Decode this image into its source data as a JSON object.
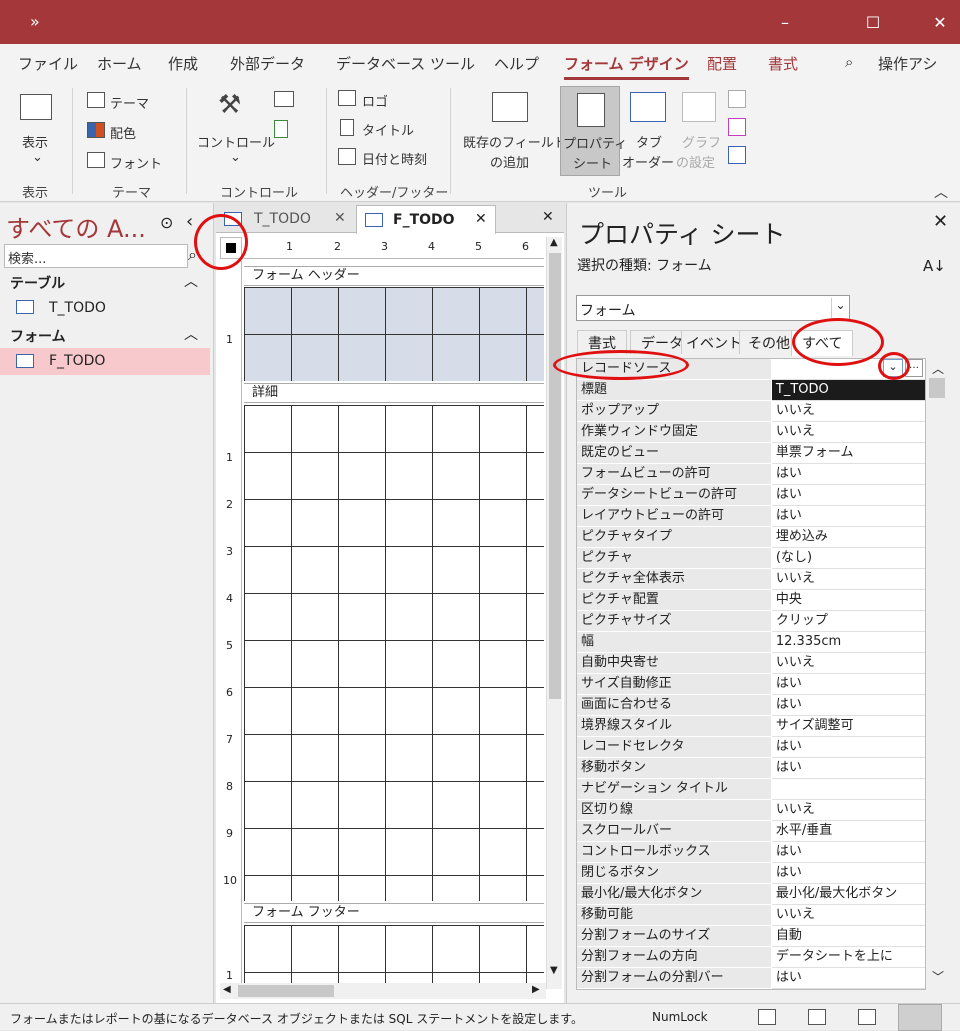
{
  "titlebar": {
    "qat_chevron": "»",
    "min": "–",
    "max": "☐",
    "close": "✕"
  },
  "menu": [
    "ファイル",
    "ホーム",
    "作成",
    "外部データ",
    "データベース ツール",
    "ヘルプ",
    "フォーム デザイン",
    "配置",
    "書式"
  ],
  "tell_me": "操作アシ",
  "ribbon": {
    "view_label": "表示",
    "theme_label": "テーマ",
    "colors_label": "配色",
    "fonts_label": "フォント",
    "controls_label": "コントロール",
    "logo_label": "ロゴ",
    "title_label": "タイトル",
    "datetime_label": "日付と時刻",
    "add_fields_line1": "既存のフィールド",
    "add_fields_line2": "の追加",
    "property_sheet_line1": "プロパティ",
    "property_sheet_line2": "シート",
    "tab_order_line1": "タブ",
    "tab_order_line2": "オーダー",
    "chart_settings_line1": "グラフ",
    "chart_settings_line2": "の設定",
    "groups": {
      "view": "表示",
      "themes": "テーマ",
      "controls": "コントロール",
      "header_footer": "ヘッダー/フッター",
      "tools": "ツール"
    }
  },
  "nav": {
    "title": "すべての A...",
    "search_placeholder": "検索...",
    "sections": [
      {
        "label": "テーブル",
        "items": [
          "T_TODO"
        ]
      },
      {
        "label": "フォーム",
        "items": [
          "F_TODO"
        ]
      }
    ]
  },
  "doc_tabs": [
    "T_TODO",
    "F_TODO"
  ],
  "ruler_marks": [
    "1",
    "2",
    "3",
    "4",
    "5",
    "6"
  ],
  "vertical_ruler_header": [
    "1"
  ],
  "vertical_ruler_detail": [
    "1",
    "2",
    "3",
    "4",
    "5",
    "6",
    "7",
    "8",
    "9",
    "10"
  ],
  "vertical_ruler_footer": [
    "1"
  ],
  "sections": {
    "header": "フォーム ヘッダー",
    "detail": "詳細",
    "footer": "フォーム フッター"
  },
  "property_sheet": {
    "title": "プロパティ シート",
    "selection_type": "選択の種類: フォーム",
    "selected_object": "フォーム",
    "tabs": [
      "書式",
      "データ",
      "イベント",
      "その他",
      "すべて"
    ],
    "rows": [
      {
        "k": "レコードソース",
        "v": ""
      },
      {
        "k": "標題",
        "v": "T_TODO"
      },
      {
        "k": "ポップアップ",
        "v": "いいえ"
      },
      {
        "k": "作業ウィンドウ固定",
        "v": "いいえ"
      },
      {
        "k": "既定のビュー",
        "v": "単票フォーム"
      },
      {
        "k": "フォームビューの許可",
        "v": "はい"
      },
      {
        "k": "データシートビューの許可",
        "v": "はい"
      },
      {
        "k": "レイアウトビューの許可",
        "v": "はい"
      },
      {
        "k": "ピクチャタイプ",
        "v": "埋め込み"
      },
      {
        "k": "ピクチャ",
        "v": "(なし)"
      },
      {
        "k": "ピクチャ全体表示",
        "v": "いいえ"
      },
      {
        "k": "ピクチャ配置",
        "v": "中央"
      },
      {
        "k": "ピクチャサイズ",
        "v": "クリップ"
      },
      {
        "k": "幅",
        "v": "12.335cm"
      },
      {
        "k": "自動中央寄せ",
        "v": "いいえ"
      },
      {
        "k": "サイズ自動修正",
        "v": "はい"
      },
      {
        "k": "画面に合わせる",
        "v": "はい"
      },
      {
        "k": "境界線スタイル",
        "v": "サイズ調整可"
      },
      {
        "k": "レコードセレクタ",
        "v": "はい"
      },
      {
        "k": "移動ボタン",
        "v": "はい"
      },
      {
        "k": "ナビゲーション タイトル",
        "v": ""
      },
      {
        "k": "区切り線",
        "v": "いいえ"
      },
      {
        "k": "スクロールバー",
        "v": "水平/垂直"
      },
      {
        "k": "コントロールボックス",
        "v": "はい"
      },
      {
        "k": "閉じるボタン",
        "v": "はい"
      },
      {
        "k": "最小化/最大化ボタン",
        "v": "最小化/最大化ボタン"
      },
      {
        "k": "移動可能",
        "v": "いいえ"
      },
      {
        "k": "分割フォームのサイズ",
        "v": "自動"
      },
      {
        "k": "分割フォームの方向",
        "v": "データシートを上に"
      },
      {
        "k": "分割フォームの分割バー",
        "v": "はい"
      }
    ]
  },
  "status": {
    "message": "フォームまたはレポートの基になるデータベース オブジェクトまたは SQL ステートメントを設定します。",
    "numlock": "NumLock"
  },
  "colors": {
    "accent": "#a4373a",
    "annotation": "#e01010"
  }
}
